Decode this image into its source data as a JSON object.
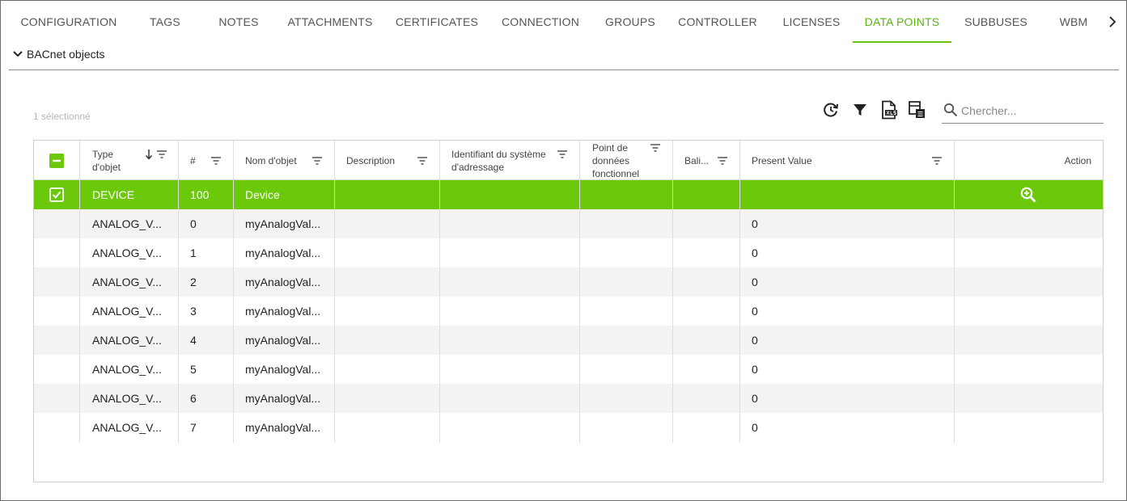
{
  "tabs": [
    {
      "label": "CONFIGURATION",
      "active": false
    },
    {
      "label": "TAGS",
      "active": false
    },
    {
      "label": "NOTES",
      "active": false
    },
    {
      "label": "ATTACHMENTS",
      "active": false
    },
    {
      "label": "CERTIFICATES",
      "active": false
    },
    {
      "label": "CONNECTION",
      "active": false
    },
    {
      "label": "GROUPS",
      "active": false
    },
    {
      "label": "CONTROLLER",
      "active": false
    },
    {
      "label": "LICENSES",
      "active": false
    },
    {
      "label": "DATA POINTS",
      "active": true
    },
    {
      "label": "SUBBUSES",
      "active": false
    },
    {
      "label": "WBM",
      "active": false
    }
  ],
  "section": {
    "title": "BACnet objects",
    "expanded": true
  },
  "toolbar": {
    "selected_count": "1 sélectionné",
    "icons": [
      "refresh-icon",
      "filter-icon",
      "export-xlsx-icon",
      "column-settings-icon"
    ],
    "search_placeholder": "Chercher..."
  },
  "table": {
    "columns": [
      {
        "label": "Type d'objet",
        "sort": "descending",
        "filter": true
      },
      {
        "label": "#",
        "filter": true
      },
      {
        "label": "Nom d'objet",
        "filter": true
      },
      {
        "label": "Description",
        "filter": true
      },
      {
        "label": "Identifiant du système d'adressage",
        "filter": true
      },
      {
        "label": "Point de données fonctionnel",
        "filter": true
      },
      {
        "label": "Bali...",
        "filter": true
      },
      {
        "label": "Present Value",
        "filter": true
      },
      {
        "label": "Action",
        "filter": false
      }
    ],
    "header_checkbox": "indeterminate",
    "rows": [
      {
        "selected": true,
        "type": "DEVICE",
        "num": "100",
        "name": "Device",
        "description": "",
        "address_id": "",
        "functional_point": "",
        "tag": "",
        "present_value": "",
        "action": "zoom-in-icon"
      },
      {
        "selected": false,
        "type": "ANALOG_V...",
        "num": "0",
        "name": "myAnalogVal...",
        "description": "",
        "address_id": "",
        "functional_point": "",
        "tag": "",
        "present_value": "0",
        "action": ""
      },
      {
        "selected": false,
        "type": "ANALOG_V...",
        "num": "1",
        "name": "myAnalogVal...",
        "description": "",
        "address_id": "",
        "functional_point": "",
        "tag": "",
        "present_value": "0",
        "action": ""
      },
      {
        "selected": false,
        "type": "ANALOG_V...",
        "num": "2",
        "name": "myAnalogVal...",
        "description": "",
        "address_id": "",
        "functional_point": "",
        "tag": "",
        "present_value": "0",
        "action": ""
      },
      {
        "selected": false,
        "type": "ANALOG_V...",
        "num": "3",
        "name": "myAnalogVal...",
        "description": "",
        "address_id": "",
        "functional_point": "",
        "tag": "",
        "present_value": "0",
        "action": ""
      },
      {
        "selected": false,
        "type": "ANALOG_V...",
        "num": "4",
        "name": "myAnalogVal...",
        "description": "",
        "address_id": "",
        "functional_point": "",
        "tag": "",
        "present_value": "0",
        "action": ""
      },
      {
        "selected": false,
        "type": "ANALOG_V...",
        "num": "5",
        "name": "myAnalogVal...",
        "description": "",
        "address_id": "",
        "functional_point": "",
        "tag": "",
        "present_value": "0",
        "action": ""
      },
      {
        "selected": false,
        "type": "ANALOG_V...",
        "num": "6",
        "name": "myAnalogVal...",
        "description": "",
        "address_id": "",
        "functional_point": "",
        "tag": "",
        "present_value": "0",
        "action": ""
      },
      {
        "selected": false,
        "type": "ANALOG_V...",
        "num": "7",
        "name": "myAnalogVal...",
        "description": "",
        "address_id": "",
        "functional_point": "",
        "tag": "",
        "present_value": "0",
        "action": ""
      }
    ]
  },
  "colors": {
    "accent": "#6cc80a",
    "active_tab_text": "#5bb710"
  }
}
